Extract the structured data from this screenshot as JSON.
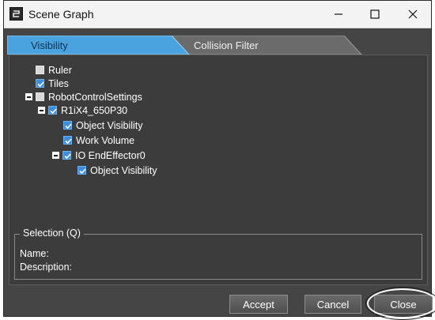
{
  "window": {
    "title": "Scene Graph",
    "app_icon": "scene-graph-app-icon",
    "controls": [
      "minimize-icon",
      "maximize-icon",
      "close-icon"
    ]
  },
  "tabs": [
    {
      "label": "Visibility",
      "active": true
    },
    {
      "label": "Collision Filter",
      "active": false
    }
  ],
  "tree": [
    {
      "label": "Ruler",
      "checked": false,
      "expander": false
    },
    {
      "label": "Tiles",
      "checked": true,
      "expander": false
    },
    {
      "label": "RobotControlSettings",
      "checked": false,
      "expander": true
    },
    {
      "label": "R1iX4_650P30",
      "checked": true,
      "expander": true
    },
    {
      "label": "Object Visibility",
      "checked": true,
      "expander": false
    },
    {
      "label": "Work Volume",
      "checked": true,
      "expander": false
    },
    {
      "label": "IO EndEffector0",
      "checked": true,
      "expander": true
    },
    {
      "label": "Object Visibility",
      "checked": true,
      "expander": false
    }
  ],
  "selection": {
    "legend": "Selection (Q)",
    "name_label": "Name:",
    "description_label": "Description:"
  },
  "buttons": {
    "accept": "Accept",
    "cancel": "Cancel",
    "close": "Close"
  },
  "colors": {
    "accent": "#3e8ede",
    "tab_active": "#4aa3df",
    "background": "#454545"
  }
}
